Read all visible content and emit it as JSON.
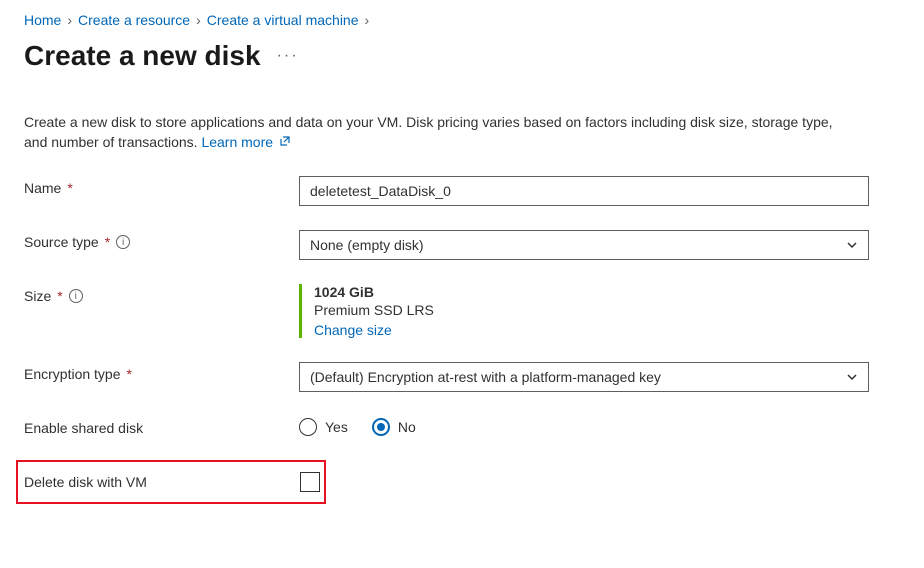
{
  "breadcrumb": {
    "items": [
      "Home",
      "Create a resource",
      "Create a virtual machine"
    ]
  },
  "title": "Create a new disk",
  "description": "Create a new disk to store applications and data on your VM. Disk pricing varies based on factors including disk size, storage type, and number of transactions.",
  "learn_more": "Learn more",
  "form": {
    "name": {
      "label": "Name",
      "value": "deletetest_DataDisk_0"
    },
    "source_type": {
      "label": "Source type",
      "value": "None (empty disk)"
    },
    "size": {
      "label": "Size",
      "value": "1024 GiB",
      "type": "Premium SSD LRS",
      "change": "Change size"
    },
    "encryption": {
      "label": "Encryption type",
      "value": "(Default) Encryption at-rest with a platform-managed key"
    },
    "enable_shared": {
      "label": "Enable shared disk",
      "yes": "Yes",
      "no": "No",
      "selected": "No"
    },
    "delete_with_vm": {
      "label": "Delete disk with VM",
      "checked": false
    }
  }
}
